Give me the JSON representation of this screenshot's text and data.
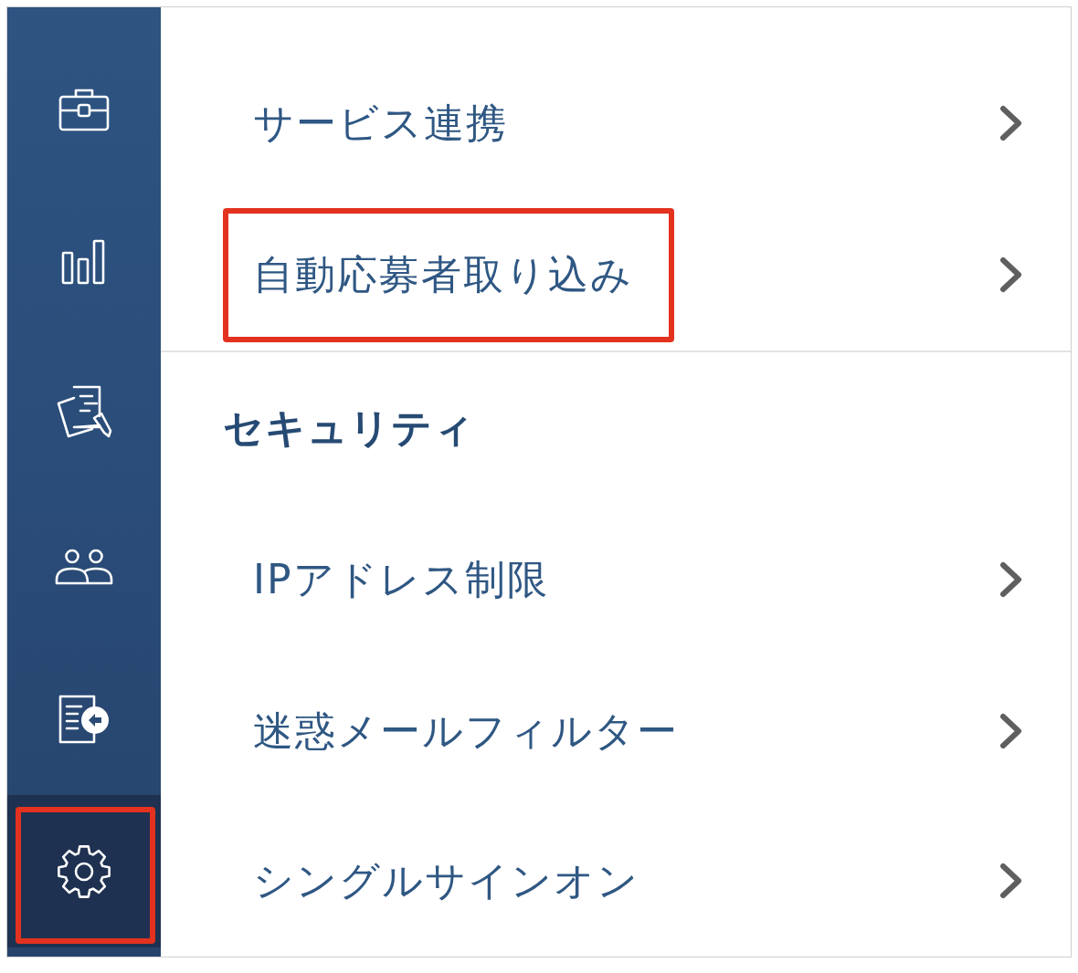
{
  "sidebar": {
    "items": [
      {
        "selected": false,
        "highlighted": false
      },
      {
        "selected": false,
        "highlighted": false
      },
      {
        "selected": false,
        "highlighted": false
      },
      {
        "selected": false,
        "highlighted": false
      },
      {
        "selected": false,
        "highlighted": false
      },
      {
        "selected": true,
        "highlighted": true
      }
    ]
  },
  "menu": {
    "sections": [
      {
        "items": [
          {
            "label": "サービス連携",
            "highlighted": false
          },
          {
            "label": "自動応募者取り込み",
            "highlighted": true
          }
        ]
      },
      {
        "heading": "セキュリティ",
        "items": [
          {
            "label": "IPアドレス制限",
            "highlighted": false
          },
          {
            "label": "迷惑メールフィルター",
            "highlighted": false
          },
          {
            "label": "シングルサインオン",
            "highlighted": false
          }
        ]
      }
    ]
  }
}
